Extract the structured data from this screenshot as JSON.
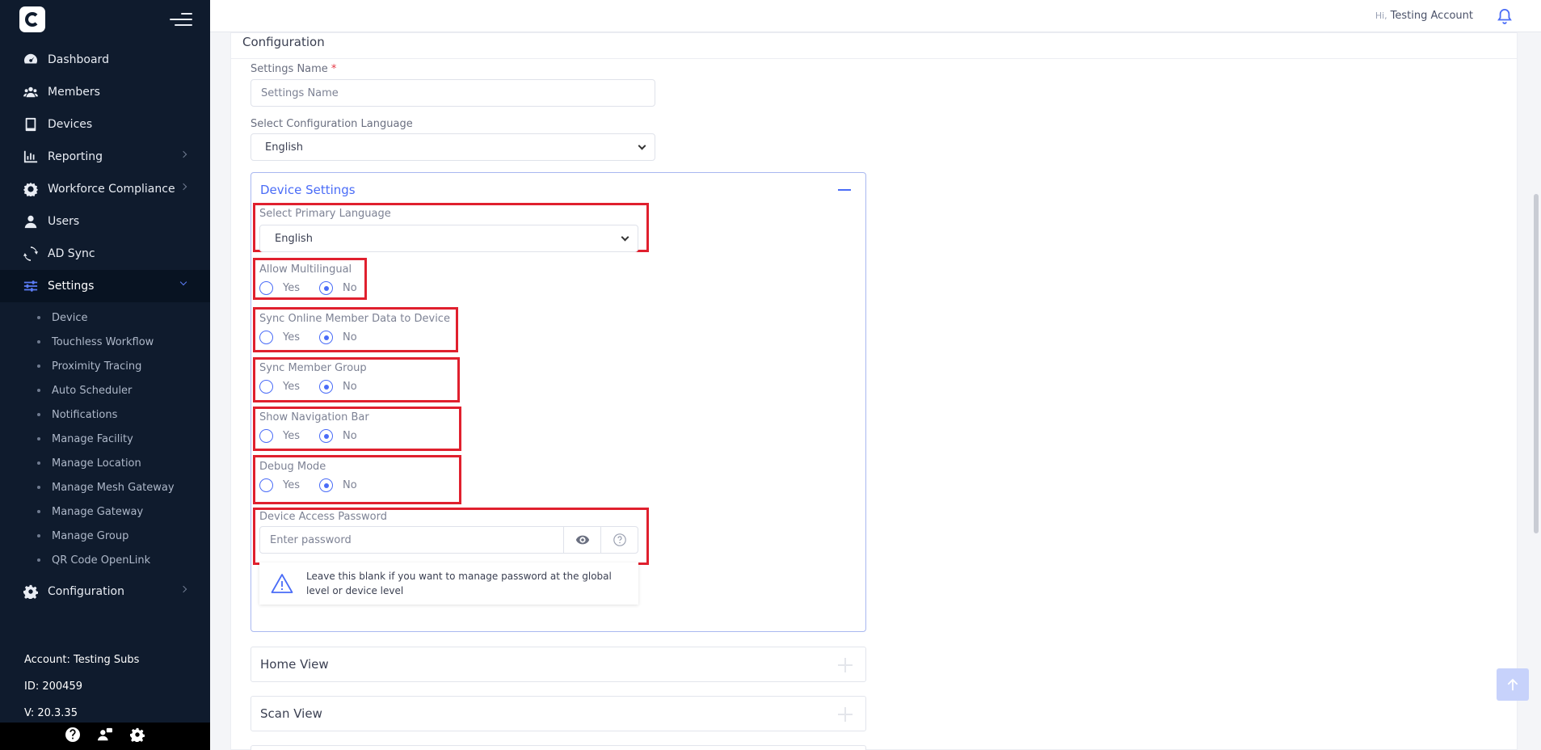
{
  "sidebar": {
    "items": [
      {
        "label": "Dashboard",
        "icon": "gauge-icon"
      },
      {
        "label": "Members",
        "icon": "users-icon"
      },
      {
        "label": "Devices",
        "icon": "tablet-icon"
      },
      {
        "label": "Reporting",
        "icon": "bar-chart-icon"
      },
      {
        "label": "Workforce Compliance",
        "icon": "gear-shield-icon"
      },
      {
        "label": "Users",
        "icon": "user-icon"
      },
      {
        "label": "AD Sync",
        "icon": "sync-icon"
      },
      {
        "label": "Settings",
        "icon": "sliders-icon"
      },
      {
        "label": "Configuration",
        "icon": "gear-icon"
      }
    ],
    "settings_sub": [
      "Device",
      "Touchless Workflow",
      "Proximity Tracing",
      "Auto Scheduler",
      "Notifications",
      "Manage Facility",
      "Manage Location",
      "Manage Mesh Gateway",
      "Manage Gateway",
      "Manage Group",
      "QR Code OpenLink"
    ],
    "account": "Account: Testing Subs",
    "id": "ID: 200459",
    "version": "V: 20.3.35"
  },
  "topbar": {
    "hi": "Hi,",
    "user": "Testing Account"
  },
  "config": {
    "title": "Configuration",
    "settings_name_label": "Settings Name",
    "required_mark": "*",
    "settings_name_placeholder": "Settings Name",
    "language_label": "Select Configuration Language",
    "language_value": "English"
  },
  "device_settings": {
    "title": "Device Settings",
    "primary_language_label": "Select Primary Language",
    "primary_language_value": "English",
    "yes": "Yes",
    "no": "No",
    "groups": [
      {
        "label": "Allow Multilingual",
        "value": "No"
      },
      {
        "label": "Sync Online Member Data to Device",
        "value": "No"
      },
      {
        "label": "Sync Member Group",
        "value": "No"
      },
      {
        "label": "Show Navigation Bar",
        "value": "No"
      },
      {
        "label": "Debug Mode",
        "value": "No"
      }
    ],
    "password_label": "Device Access Password",
    "password_placeholder": "Enter password",
    "password_hint": "Leave this blank if you want to manage password at the global level or device level"
  },
  "sections": [
    "Home View",
    "Scan View"
  ],
  "colors": {
    "accent": "#4a6cf7",
    "highlight": "#e0202e",
    "sidebar": "#0f1b2d"
  }
}
